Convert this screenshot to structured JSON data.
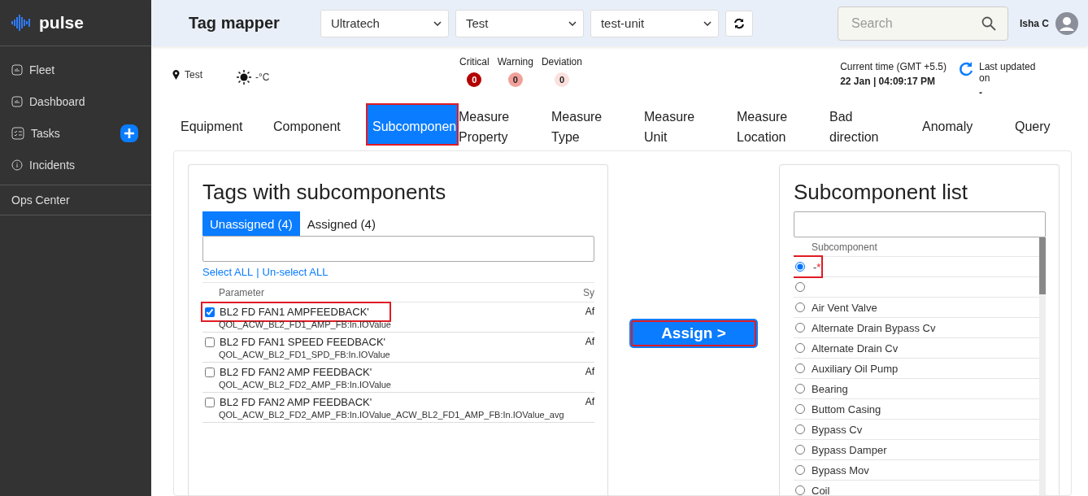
{
  "sidebar": {
    "brand": "pulse",
    "items": [
      {
        "kind": "chart",
        "label": "Fleet"
      },
      {
        "kind": "chart",
        "label": "Dashboard"
      },
      {
        "kind": "tasks",
        "label": "Tasks",
        "add": true
      },
      {
        "kind": "info",
        "label": "Incidents"
      }
    ],
    "section": "Ops Center"
  },
  "header": {
    "title": "Tag mapper",
    "selects": [
      "Ultratech",
      "Test",
      "test-unit"
    ],
    "search": {
      "placeholder": "Search"
    },
    "user": "Isha C"
  },
  "info": {
    "location": "Test",
    "temperature": "-°C",
    "alerts": [
      {
        "label": "Critical",
        "count": "0",
        "color": "#b30000"
      },
      {
        "label": "Warning",
        "count": "0",
        "color": "#f2a09a"
      },
      {
        "label": "Deviation",
        "count": "0",
        "color": "#fbe0dd"
      }
    ],
    "time_label": "Current time (GMT +5.5)",
    "time": "22 Jan | 04:09:17 PM",
    "updated_label": "Last updated on",
    "updated": "-"
  },
  "tabs": [
    {
      "label": "Equipment",
      "selected": false,
      "annotated": false
    },
    {
      "label": "Component",
      "selected": false,
      "annotated": false
    },
    {
      "label": "Subcomponen",
      "selected": true,
      "annotated": true
    },
    {
      "label": "Measure Property",
      "selected": false,
      "annotated": false
    },
    {
      "label": "Measure Type",
      "selected": false,
      "annotated": false
    },
    {
      "label": "Measure Unit",
      "selected": false,
      "annotated": false
    },
    {
      "label": "Measure Location",
      "selected": false,
      "annotated": false
    },
    {
      "label": "Bad direction",
      "selected": false,
      "annotated": false
    },
    {
      "label": "Anomaly",
      "selected": false,
      "annotated": false
    },
    {
      "label": "Query",
      "selected": false,
      "annotated": false
    }
  ],
  "tags": {
    "title": "Tags with subcomponents",
    "subtabs": [
      {
        "label": "Unassigned (4)",
        "selected": true
      },
      {
        "label": "Assigned (4)",
        "selected": false
      }
    ],
    "select_all": "Select ALL",
    "separator": "|",
    "unselect_all": "Un-select ALL",
    "columns": [
      "Parameter",
      "Sy"
    ],
    "rows": [
      {
        "name": "BL2 FD FAN1 AMPFEEDBACK'",
        "tag": "QOL_ACW_BL2_FD1_AMP_FB:In.IOValue",
        "column_2": "Af",
        "checked": true,
        "annotated": true
      },
      {
        "name": "BL2 FD FAN1 SPEED FEEDBACK'",
        "tag": "QOL_ACW_BL2_FD1_SPD_FB:In.IOValue",
        "column_2": "Af",
        "checked": false,
        "annotated": false
      },
      {
        "name": "BL2 FD FAN2 AMP FEEDBACK'",
        "tag": "QOL_ACW_BL2_FD2_AMP_FB:In.IOValue",
        "column_2": "Af",
        "checked": false,
        "annotated": false
      },
      {
        "name": "BL2 FD FAN2 AMP FEEDBACK'",
        "tag": "QOL_ACW_BL2_FD2_AMP_FB:In.IOValue_ACW_BL2_FD1_AMP_FB:In.IOValue_avg",
        "column_2": "Af",
        "checked": false,
        "annotated": false
      }
    ]
  },
  "assign": {
    "label": "Assign >",
    "annotated": true
  },
  "subcomponents": {
    "title": "Subcomponent list",
    "column": "Subcomponent",
    "items": [
      {
        "label": "-",
        "mark": "*",
        "selected": true,
        "annotated": true
      },
      {
        "selected": false
      },
      {
        "label": "Air Vent Valve",
        "selected": false
      },
      {
        "label": "Alternate Drain Bypass Cv",
        "selected": false
      },
      {
        "label": "Alternate Drain Cv",
        "selected": false
      },
      {
        "label": "Auxiliary Oil Pump",
        "selected": false
      },
      {
        "label": "Bearing",
        "selected": false
      },
      {
        "label": "Buttom Casing",
        "selected": false
      },
      {
        "label": "Bypass Cv",
        "selected": false
      },
      {
        "label": "Bypass Damper",
        "selected": false
      },
      {
        "label": "Bypass Mov",
        "selected": false
      },
      {
        "label": "Coil",
        "selected": false
      }
    ]
  }
}
